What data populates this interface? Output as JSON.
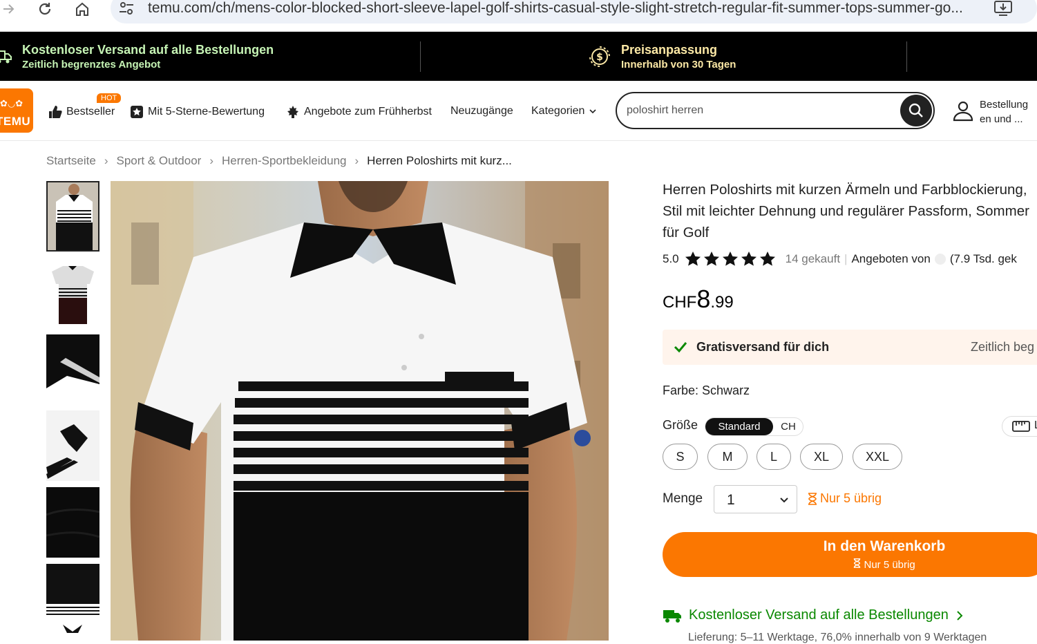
{
  "browser": {
    "url": "temu.com/ch/mens-color-blocked-short-sleeve-lapel-golf-shirts-casual-style-slight-stretch-regular-fit-summer-tops-summer-go..."
  },
  "promo": {
    "left_title": "Kostenloser Versand auf alle Bestellungen",
    "left_sub": "Zeitlich begrenztes Angebot",
    "right_title": "Preisanpassung",
    "right_sub": "Innerhalb von 30 Tagen",
    "left_color": "#c6f4b5",
    "right_color": "#fde9a6"
  },
  "nav": {
    "logo_text": "TEMU",
    "hot_badge": "HOT",
    "items": [
      {
        "label": "Bestseller",
        "icon": "thumbs-up-icon"
      },
      {
        "label": "Mit 5-Sterne-Bewertung",
        "icon": "star-badge-icon"
      },
      {
        "label": "Angebote zum Frühherbst",
        "icon": "maple-leaf-icon"
      },
      {
        "label": "Neuzugänge"
      },
      {
        "label": "Kategorien",
        "icon": "chevron-down-icon"
      }
    ],
    "search_value": "poloshirt herren",
    "orders_line1": "Bestellung",
    "orders_line2": "en und ..."
  },
  "breadcrumb": [
    "Startseite",
    "Sport & Outdoor",
    "Herren-Sportbekleidung",
    "Herren Poloshirts mit kurz..."
  ],
  "product": {
    "title": "Herren Poloshirts mit kurzen Ärmeln und Farbblockierung, Stil mit leichter Dehnung und regulärer Passform, Sommer für Golf",
    "rating": "5.0",
    "stars": 5,
    "sold": "14 gekauft",
    "seller_prefix": "Angeboten von",
    "seller_stats": "(7.9 Tsd. gek",
    "price_currency": "CHF",
    "price_main": "8",
    "price_cents": ".99",
    "shipping_label": "Gratisversand für dich",
    "shipping_right": "Zeitlich beg",
    "color_label": "Farbe: Schwarz",
    "size_label": "Größe",
    "size_system_active": "Standard",
    "size_system_other": "CH",
    "sizes": [
      "S",
      "M",
      "L",
      "XL",
      "XXL"
    ],
    "qty_label": "Menge",
    "qty_value": "1",
    "stock_text": "Nur 5 übrig",
    "cart_label": "In den Warenkorb",
    "cart_sub": "Nur 5 übrig",
    "free_ship": "Kostenloser Versand auf alle Bestellungen",
    "delivery": "Lieferung: 5–11 Werktage, 76,0% innerhalb von 9 Werktagen",
    "accent": "#fb7701",
    "green": "#0a8800"
  }
}
